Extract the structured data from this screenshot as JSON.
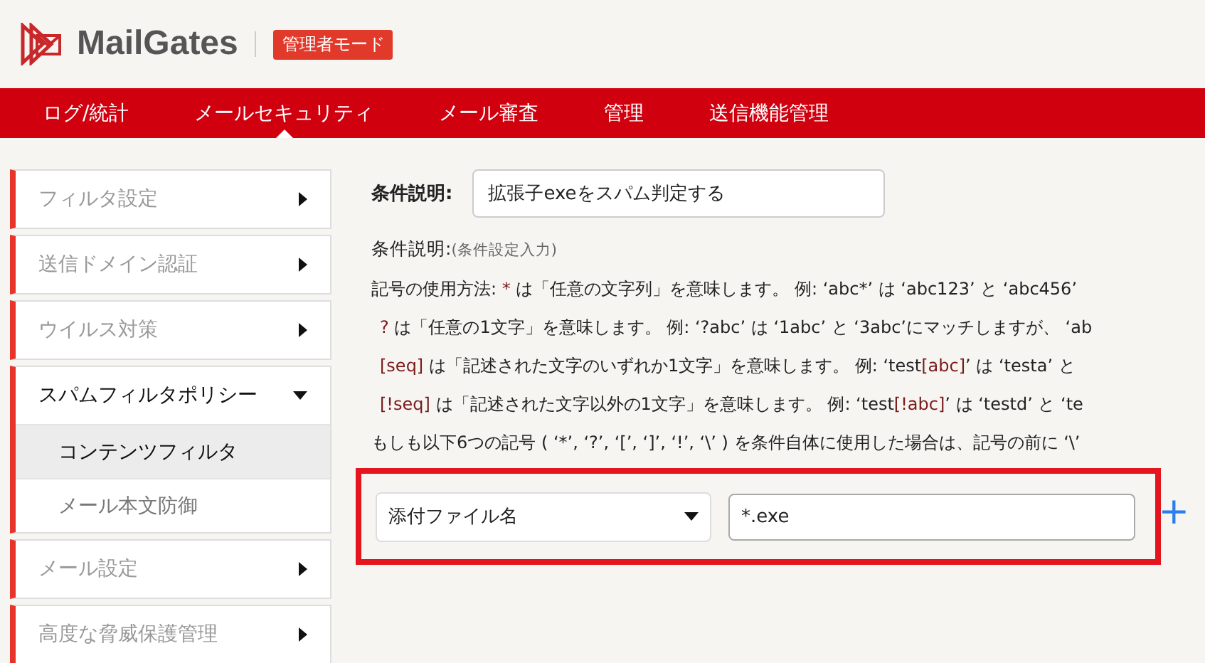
{
  "header": {
    "logo": "MailGates",
    "mode_badge": "管理者モード"
  },
  "nav": [
    {
      "label": "ログ/統計",
      "selected": false
    },
    {
      "label": "メールセキュリティ",
      "selected": true
    },
    {
      "label": "メール審査",
      "selected": false
    },
    {
      "label": "管理",
      "selected": false
    },
    {
      "label": "送信機能管理",
      "selected": false
    }
  ],
  "sidebar": [
    {
      "label": "フィルタ設定",
      "expanded": false
    },
    {
      "label": "送信ドメイン認証",
      "expanded": false
    },
    {
      "label": "ウイルス対策",
      "expanded": false
    },
    {
      "label": "スパムフィルタポリシー",
      "expanded": true,
      "children": [
        {
          "label": "コンテンツフィルタ",
          "selected": true
        },
        {
          "label": "メール本文防御",
          "selected": false
        }
      ]
    },
    {
      "label": "メール設定",
      "expanded": false
    },
    {
      "label": "高度な脅威保護管理",
      "expanded": false
    }
  ],
  "form": {
    "label": "条件説明:",
    "value": "拡張子exeをスパム判定する"
  },
  "section": {
    "title": "条件説明:",
    "hint": "(条件設定入力)"
  },
  "help_lines": [
    [
      {
        "kind": "plain",
        "text": "記号の使用方法: "
      },
      {
        "kind": "symbol",
        "text": "*"
      },
      {
        "kind": "plain",
        "text": " は「任意の文字列」を意味します。 例: ‘abc*’ は ‘abc123’ と ‘abc456’"
      }
    ],
    [
      {
        "kind": "symbol",
        "text": "?"
      },
      {
        "kind": "plain",
        "text": " は「任意の1文字」を意味します。 例: ‘?abc’ は ‘1abc’ と ‘3abc’にマッチしますが、 ‘ab"
      }
    ],
    [
      {
        "kind": "symbol",
        "text": "[seq]"
      },
      {
        "kind": "plain",
        "text": " は「記述された文字のいずれか1文字」を意味します。 例: ‘test"
      },
      {
        "kind": "symbol",
        "text": "[abc]"
      },
      {
        "kind": "plain",
        "text": "’ は ‘testa’ と"
      }
    ],
    [
      {
        "kind": "symbol",
        "text": "[!seq]"
      },
      {
        "kind": "plain",
        "text": " は「記述された文字以外の1文字」を意味します。 例: ‘test"
      },
      {
        "kind": "symbol",
        "text": "[!abc]"
      },
      {
        "kind": "plain",
        "text": "’ は ‘testd’ と ‘te"
      }
    ],
    [
      {
        "kind": "plain",
        "text": "もしも以下6つの記号 ( ‘*’, ‘?’, ‘[’, ‘]’, ‘!’, ‘\\’ ) を条件自体に使用した場合は、記号の前に ‘\\’"
      }
    ]
  ],
  "condition": {
    "field": "添付ファイル名",
    "pattern": "*.exe",
    "add": "+"
  }
}
